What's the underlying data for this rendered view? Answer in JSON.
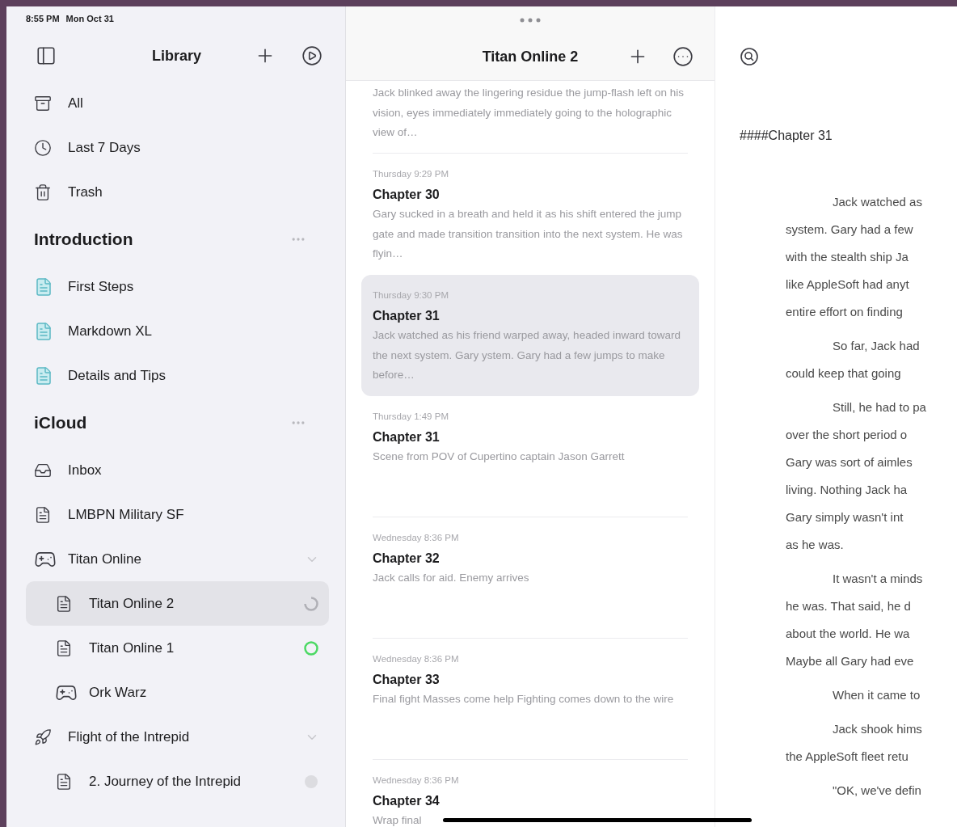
{
  "status_bar": {
    "time": "8:55 PM",
    "date": "Mon Oct 31"
  },
  "sidebar": {
    "title": "Library",
    "library": [
      {
        "label": "All",
        "kind": "archive",
        "selected": false
      },
      {
        "label": "Last 7 Days",
        "kind": "clock",
        "selected": false
      },
      {
        "label": "Trash",
        "kind": "trash",
        "selected": false
      }
    ],
    "sections": [
      {
        "title": "Introduction",
        "items": [
          {
            "label": "First Steps",
            "kind": "guide",
            "selected": false
          },
          {
            "label": "Markdown XL",
            "kind": "guide",
            "selected": false
          },
          {
            "label": "Details and Tips",
            "kind": "guide",
            "selected": false
          }
        ]
      },
      {
        "title": "iCloud",
        "items": [
          {
            "label": "Inbox",
            "kind": "inbox",
            "selected": false
          },
          {
            "label": "LMBPN Military SF",
            "kind": "document",
            "selected": false
          },
          {
            "label": "Titan Online",
            "kind": "game",
            "selected": false,
            "expanded": true,
            "children": [
              {
                "label": "Titan Online 2",
                "kind": "document",
                "selected": true,
                "status": {
                  "kind": "syncing"
                }
              },
              {
                "label": "Titan Online 1",
                "kind": "document",
                "selected": false,
                "status": {
                  "kind": "synced"
                }
              },
              {
                "label": "Ork Warz",
                "kind": "game",
                "selected": false
              }
            ]
          },
          {
            "label": "Flight of the Intrepid",
            "kind": "rocket",
            "selected": false,
            "expanded": true,
            "children": [
              {
                "label": "2. Journey of the Intrepid",
                "kind": "document",
                "selected": false,
                "status": {
                  "kind": "pending"
                }
              }
            ]
          }
        ]
      }
    ]
  },
  "list": {
    "title": "Titan Online 2",
    "entries": [
      {
        "preview": "Jack blinked away the lingering residue the jump-flash left on his vision, eyes immediately immediately going to the holographic view of…",
        "selected": false
      },
      {
        "date": "Thursday 9:29 PM",
        "title": "Chapter 30",
        "preview": "Gary sucked in a breath and held it as his shift entered the jump gate and made transition transition into the next system. He was flyin…",
        "selected": false
      },
      {
        "date": "Thursday 9:30 PM",
        "title": "Chapter 31",
        "preview": "Jack watched as his friend warped away, headed inward toward the next system. Gary ystem. Gary had a few jumps to make before…",
        "selected": true
      },
      {
        "date": "Thursday 1:49 PM",
        "title": "Chapter 31",
        "preview": "Scene from POV of Cupertino captain Jason Garrett",
        "selected": false
      },
      {
        "date": "Wednesday 8:36 PM",
        "title": "Chapter 32",
        "preview": "Jack calls for aid. Enemy arrives",
        "selected": false
      },
      {
        "date": "Wednesday 8:36 PM",
        "title": "Chapter 33",
        "preview": "Final fight Masses come help Fighting comes down to the wire",
        "selected": false
      },
      {
        "date": "Wednesday 8:36 PM",
        "title": "Chapter 34",
        "preview": "Wrap final",
        "selected": false
      }
    ]
  },
  "editor": {
    "heading": "####Chapter 31",
    "paragraphs": [
      [
        "Jack watched as",
        "system. Gary had a few",
        "with the stealth ship Ja",
        "like AppleSoft had anyt",
        "entire effort on finding"
      ],
      [
        "So far, Jack had",
        "could keep that going"
      ],
      [
        "Still, he had to pa",
        "over the short period o",
        "Gary was sort of aimles",
        "living. Nothing Jack ha",
        "Gary simply wasn't int",
        "as he was."
      ],
      [
        "It wasn't a minds",
        "he was. That said, he d",
        "about the world. He wa",
        "Maybe all Gary had eve"
      ],
      [
        "When it came to"
      ],
      [
        "Jack shook hims",
        "the AppleSoft fleet retu"
      ],
      [
        "\"OK, we've defin"
      ]
    ]
  }
}
